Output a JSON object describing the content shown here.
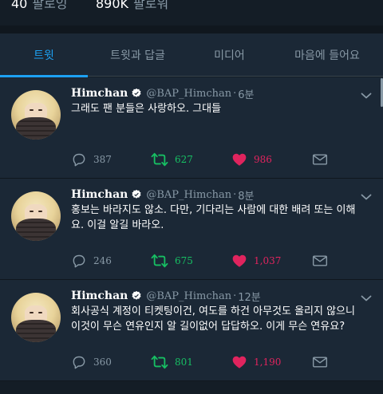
{
  "profile_stats": {
    "following_count": "40",
    "following_label": "팔로잉",
    "followers_count": "890K",
    "followers_label": "팔로워"
  },
  "tabs": [
    {
      "label": "트윗",
      "active": true
    },
    {
      "label": "트윗과 답글",
      "active": false
    },
    {
      "label": "미디어",
      "active": false
    },
    {
      "label": "마음에 들어요",
      "active": false
    }
  ],
  "colors": {
    "accent": "#1da1f2",
    "background": "#1b2836",
    "retweet": "#17bf63",
    "like": "#e0245e",
    "muted": "#8899a6"
  },
  "tweets": [
    {
      "name": "Himchan",
      "handle": "@BAP_Himchan",
      "separator": "·",
      "time": "6분",
      "text": "그래도 팬 분들은 사랑하오. 그대들",
      "replies": "387",
      "retweets": "627",
      "likes": "986",
      "icons": [
        "reply-icon",
        "retweet-icon",
        "heart-icon",
        "envelope-icon"
      ]
    },
    {
      "name": "Himchan",
      "handle": "@BAP_Himchan",
      "separator": "·",
      "time": "8분",
      "text": "홍보는 바라지도 않소. 다만, 기다리는 사람에 대한 배려 또는 이해요. 이걸 알길 바라오.",
      "replies": "246",
      "retweets": "675",
      "likes": "1,037",
      "icons": [
        "reply-icon",
        "retweet-icon",
        "heart-icon",
        "envelope-icon"
      ]
    },
    {
      "name": "Himchan",
      "handle": "@BAP_Himchan",
      "separator": "·",
      "time": "12분",
      "text": "회사공식 계정이 티켓팅이건, 여도를 하건 아무것도 올리지 않으니 이것이 무슨 연유인지 알 길이없어 답답하오. 이게 무슨 연유요?",
      "replies": "360",
      "retweets": "801",
      "likes": "1,190",
      "icons": [
        "reply-icon",
        "retweet-icon",
        "heart-icon",
        "envelope-icon"
      ]
    }
  ]
}
